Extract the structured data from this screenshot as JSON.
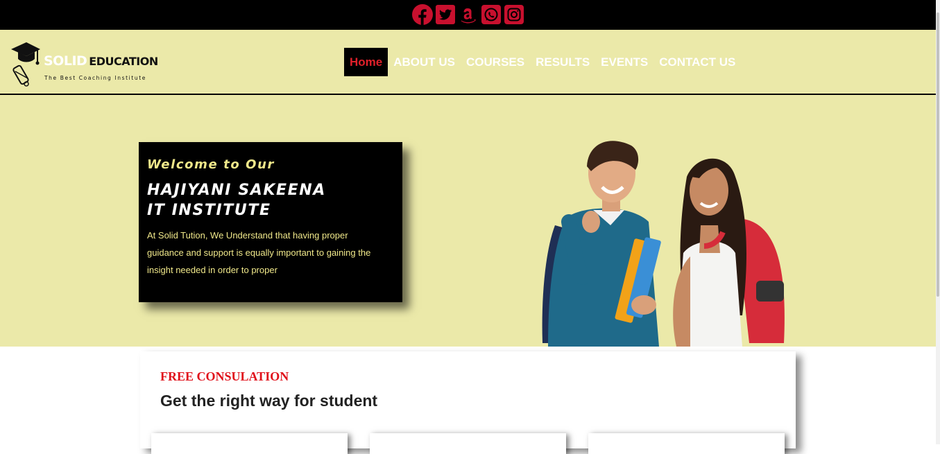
{
  "social": {
    "icons": [
      "facebook-icon",
      "twitter-icon",
      "amazon-icon",
      "whatsapp-icon",
      "instagram-icon"
    ],
    "color": "#c8102e"
  },
  "brand": {
    "name": "SOLID",
    "name2": "EDUCATION",
    "tagline": "The Best Coaching Institute"
  },
  "nav": {
    "items": [
      "Home",
      "ABOUT US",
      "COURSES",
      "RESULTS",
      "EVENTS",
      "CONTACT US"
    ],
    "active": "Home",
    "active_color": "#e0202a"
  },
  "hero": {
    "welcome": "Welcome to Our",
    "title": "HAJIYANI SAKEENA\nIT INSTITUTE",
    "text": "At Solid Tution, We Understand that having proper guidance and support is equally important to gaining the insight needed in order to proper",
    "background": "#ebe9a9"
  },
  "consultation": {
    "label": "FREE CONSULATION",
    "title": "Get the right way for student"
  }
}
